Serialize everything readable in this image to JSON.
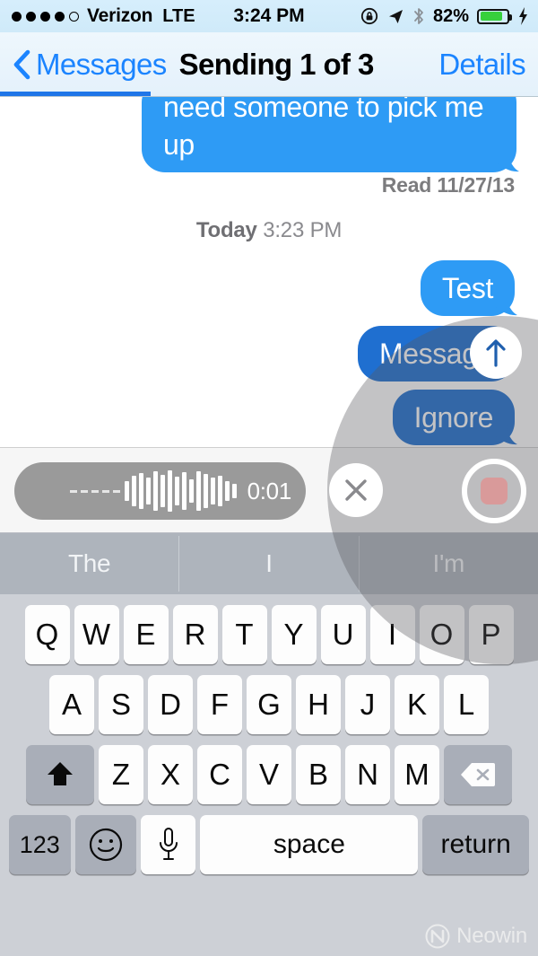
{
  "status_bar": {
    "signal_dots_filled": 4,
    "signal_dots_total": 5,
    "carrier": "Verizon",
    "network_type": "LTE",
    "time": "3:24 PM",
    "battery_percent": "82%",
    "battery_level": 82,
    "icons": [
      "rotation-lock-icon",
      "location-arrow-icon",
      "bluetooth-icon",
      "battery-icon",
      "charging-bolt-icon"
    ]
  },
  "nav_bar": {
    "back_label": "Messages",
    "title": "Sending 1 of 3",
    "details_label": "Details",
    "send_progress_percent": 28
  },
  "transcript": {
    "previous_message": {
      "text": "need someone to pick me up",
      "direction": "outgoing",
      "status": "Read 11/27/13"
    },
    "day_stamp": {
      "day": "Today",
      "time": "3:23 PM"
    },
    "messages": [
      {
        "text": "Test",
        "direction": "outgoing",
        "state": "sent"
      },
      {
        "text": "Message",
        "direction": "outgoing",
        "state": "sending"
      },
      {
        "text": "Ignore",
        "direction": "outgoing",
        "state": "sending"
      }
    ]
  },
  "send_indicator": {
    "icon": "arrow-up-icon"
  },
  "recorder": {
    "timer": "0:01",
    "cancel_icon": "close-x-icon",
    "stop_icon": "stop-record-icon",
    "waveform_bars": [
      22,
      34,
      40,
      30,
      44,
      36,
      46,
      32,
      42,
      26,
      44,
      38,
      30,
      34,
      22,
      16
    ]
  },
  "predictive_bar": {
    "suggestions": [
      "The",
      "I",
      "I'm"
    ]
  },
  "keyboard": {
    "row1": [
      "Q",
      "W",
      "E",
      "R",
      "T",
      "Y",
      "U",
      "I",
      "O",
      "P"
    ],
    "row2": [
      "A",
      "S",
      "D",
      "F",
      "G",
      "H",
      "J",
      "K",
      "L"
    ],
    "row3": [
      "Z",
      "X",
      "C",
      "V",
      "B",
      "N",
      "M"
    ],
    "shift_label": "shift-up-arrow-icon",
    "backspace_label": "backspace-icon",
    "numbers_key": "123",
    "emoji_key": "emoji-smiley-icon",
    "dictation_key": "microphone-icon",
    "space_key": "space",
    "return_key": "return"
  },
  "watermark": {
    "text": "Neowin"
  },
  "colors": {
    "bubble_sent": "#2e9bf5",
    "bubble_sending": "#1f6fd0",
    "tint_blue": "#1b84ff",
    "progress_blue": "#1f76e8",
    "battery_green": "#37d03c",
    "record_red": "#d99a9a",
    "keyboard_bg": "#cdd0d6",
    "predictive_bg": "#aeb4bc"
  }
}
